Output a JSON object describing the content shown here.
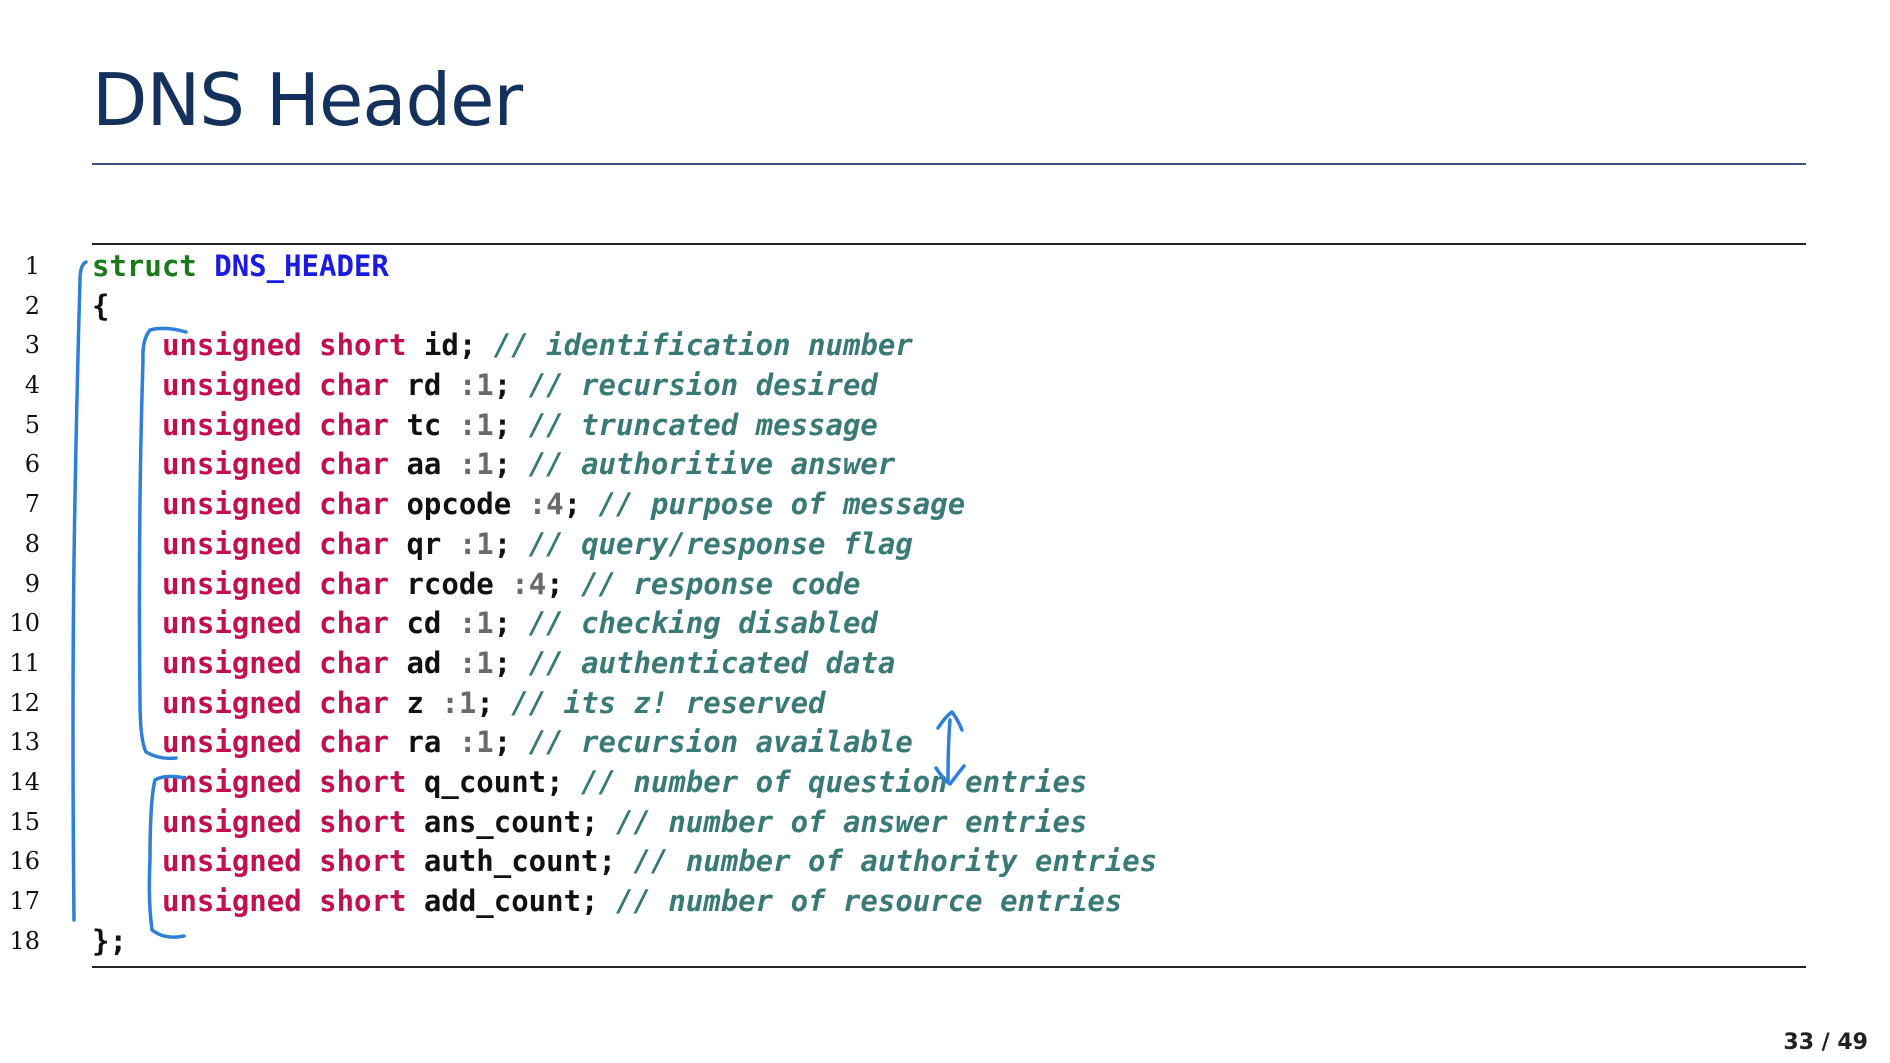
{
  "slide": {
    "title": "DNS Header",
    "page": "33 / 49"
  },
  "colors": {
    "title": "#13315c",
    "keyword_struct": "#1c7a1c",
    "struct_name": "#1b1be0",
    "type_keyword": "#c0114d",
    "comment": "#3a7a76",
    "bitfield": "#6a6a6a",
    "annotation_ink": "#2f7fd8"
  },
  "code": {
    "lines": [
      {
        "num": "1",
        "indent": false,
        "struct_kw": "struct",
        "struct_name": "DNS_HEADER"
      },
      {
        "num": "2",
        "indent": false,
        "plain": "{"
      },
      {
        "num": "3",
        "indent": true,
        "type": "unsigned short",
        "field": "id",
        "bits": "",
        "comment": "// identification number"
      },
      {
        "num": "4",
        "indent": true,
        "type": "unsigned char",
        "field": "rd",
        "bits": ":1",
        "comment": "// recursion desired"
      },
      {
        "num": "5",
        "indent": true,
        "type": "unsigned char",
        "field": "tc",
        "bits": ":1",
        "comment": "// truncated message"
      },
      {
        "num": "6",
        "indent": true,
        "type": "unsigned char",
        "field": "aa",
        "bits": ":1",
        "comment": "// authoritive answer"
      },
      {
        "num": "7",
        "indent": true,
        "type": "unsigned char",
        "field": "opcode",
        "bits": ":4",
        "comment": "// purpose of message"
      },
      {
        "num": "8",
        "indent": true,
        "type": "unsigned char",
        "field": "qr",
        "bits": ":1",
        "comment": "// query/response flag"
      },
      {
        "num": "9",
        "indent": true,
        "type": "unsigned char",
        "field": "rcode",
        "bits": ":4",
        "comment": "// response code"
      },
      {
        "num": "10",
        "indent": true,
        "type": "unsigned char",
        "field": "cd",
        "bits": ":1",
        "comment": "// checking disabled"
      },
      {
        "num": "11",
        "indent": true,
        "type": "unsigned char",
        "field": "ad",
        "bits": ":1",
        "comment": "// authenticated data"
      },
      {
        "num": "12",
        "indent": true,
        "type": "unsigned char",
        "field": "z",
        "bits": ":1",
        "comment": "// its z! reserved"
      },
      {
        "num": "13",
        "indent": true,
        "type": "unsigned char",
        "field": "ra",
        "bits": ":1",
        "comment": "// recursion available"
      },
      {
        "num": "14",
        "indent": true,
        "type": "unsigned short",
        "field": "q_count",
        "bits": "",
        "comment": "// number of question entries"
      },
      {
        "num": "15",
        "indent": true,
        "type": "unsigned short",
        "field": "ans_count",
        "bits": "",
        "comment": "// number of answer entries"
      },
      {
        "num": "16",
        "indent": true,
        "type": "unsigned short",
        "field": "auth_count",
        "bits": "",
        "comment": "// number of authority entries"
      },
      {
        "num": "17",
        "indent": true,
        "type": "unsigned short",
        "field": "add_count",
        "bits": "",
        "comment": "// number of resource entries"
      },
      {
        "num": "18",
        "indent": false,
        "plain": "};"
      }
    ]
  }
}
